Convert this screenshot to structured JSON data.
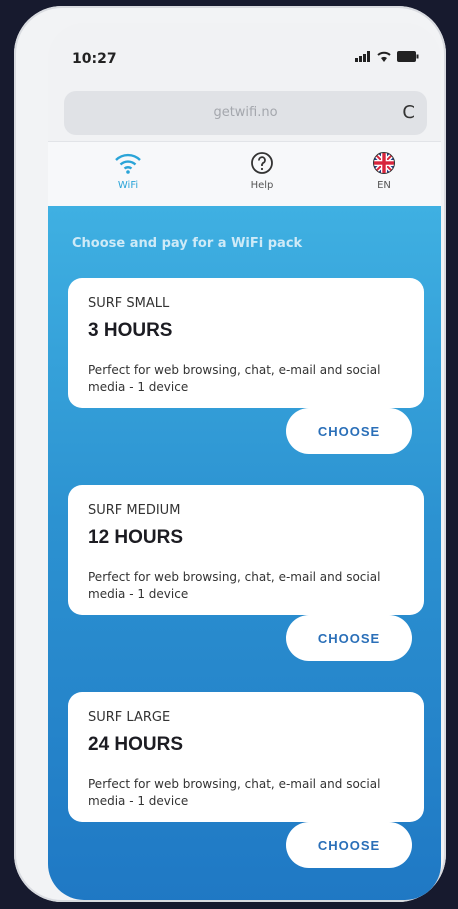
{
  "status": {
    "time": "10:27",
    "icons": [
      "signal-icon",
      "wifi-icon",
      "battery-icon"
    ]
  },
  "browser": {
    "url": "getwifi.no",
    "reload_icon": "C"
  },
  "nav": {
    "items": [
      {
        "label": "WiFi",
        "icon": "wifi-icon"
      },
      {
        "label": "Help",
        "icon": "question-icon"
      },
      {
        "label": "EN",
        "icon": "uk-flag-icon"
      }
    ]
  },
  "main": {
    "intro": "Choose and pay for a WiFi pack",
    "packages": [
      {
        "title": "SURF SMALL",
        "duration": "3 HOURS",
        "description": "Perfect for web browsing, chat, e-mail and social media - 1 device",
        "button": "CHOOSE"
      },
      {
        "title": "SURF MEDIUM",
        "duration": "12 HOURS",
        "description": "Perfect for web browsing, chat, e-mail and social media - 1 device",
        "button": "CHOOSE"
      },
      {
        "title": "SURF LARGE",
        "duration": "24 HOURS",
        "description": "Perfect for web browsing, chat, e-mail and social media - 1 device",
        "button": "CHOOSE"
      }
    ]
  },
  "colors": {
    "accent": "#2aa4d8",
    "gradient_top": "#3fb0e2",
    "gradient_bottom": "#1f78c4",
    "button_text": "#2a6fb8"
  }
}
